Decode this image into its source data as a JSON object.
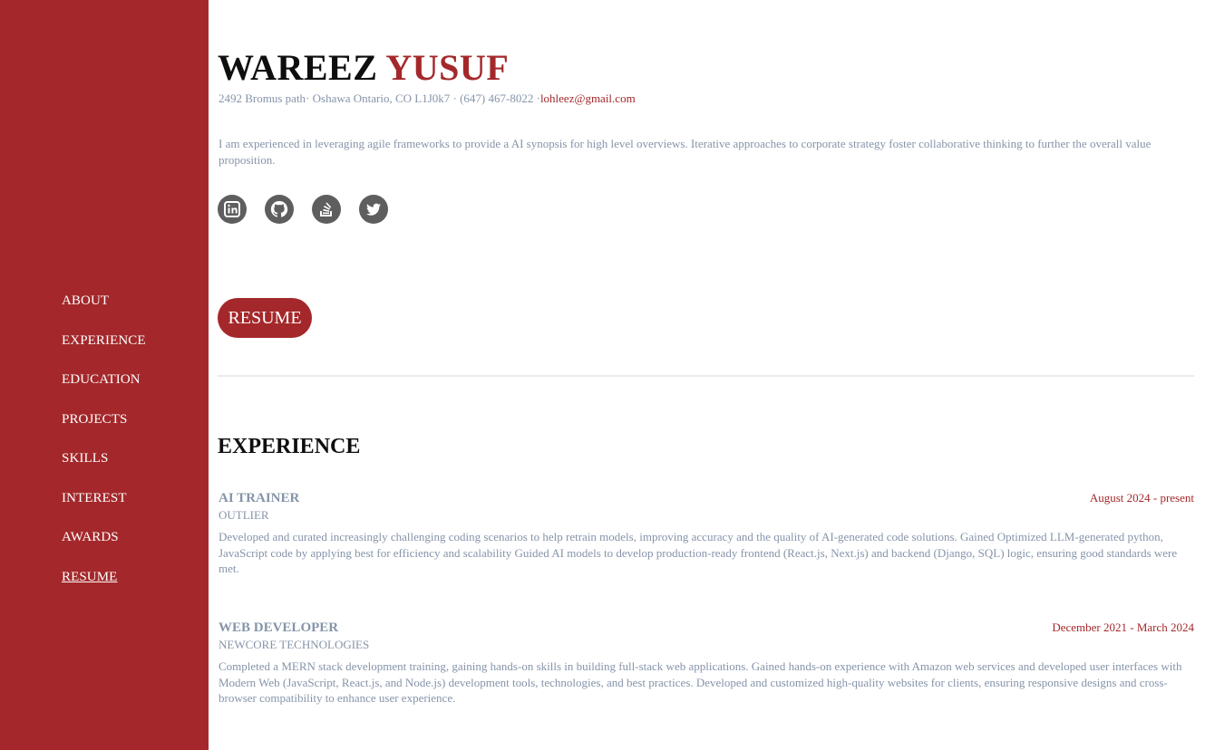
{
  "sidebar": {
    "items": [
      {
        "label": "ABOUT"
      },
      {
        "label": "EXPERIENCE"
      },
      {
        "label": "EDUCATION"
      },
      {
        "label": "PROJECTS"
      },
      {
        "label": "SKILLS"
      },
      {
        "label": "INTEREST"
      },
      {
        "label": "AWARDS"
      },
      {
        "label": "RESUME"
      }
    ]
  },
  "header": {
    "first_name": "WAREEZ",
    "last_name": "YUSUF",
    "address": "2492 Bromus path· Oshawa Ontario, CO L1J0k7 · (647) 467-8022 ·",
    "email": "lohleez@gmail.com",
    "bio": "I am experienced in leveraging agile frameworks to provide a AI synopsis for high level overviews. Iterative approaches to corporate strategy foster collaborative thinking to further the overall value proposition."
  },
  "socials": [
    {
      "icon": "linkedin-icon"
    },
    {
      "icon": "github-icon"
    },
    {
      "icon": "stack-overflow-icon"
    },
    {
      "icon": "twitter-icon"
    }
  ],
  "resume_button": "RESUME",
  "experience": {
    "title": "EXPERIENCE",
    "jobs": [
      {
        "title": "AI TRAINER",
        "company": "OUTLIER",
        "date": "August 2024 - present",
        "description": "Developed and curated increasingly challenging coding scenarios to help retrain models, improving accuracy and the quality of AI-generated code solutions. Gained Optimized LLM-generated python, JavaScript code by applying best for efficiency and scalability Guided AI models to develop production-ready frontend (React.js, Next.js) and backend (Django, SQL) logic, ensuring good standards were met."
      },
      {
        "title": "WEB DEVELOPER",
        "company": "NEWCORE TECHNOLOGIES",
        "date": "December 2021 - March 2024",
        "description": "Completed a MERN stack development training, gaining hands-on skills in building full-stack web applications. Gained hands-on experience with Amazon web services and developed user interfaces with Modern Web (JavaScript, React.js, and Node.js) development tools, technologies, and best practices. Developed and customized high-quality websites for clients, ensuring responsive designs and cross-browser compatibility to enhance user experience."
      }
    ]
  },
  "colors": {
    "accent": "#a4282b",
    "muted_text": "#8694a9",
    "icon_bg": "#5e5e5e"
  }
}
